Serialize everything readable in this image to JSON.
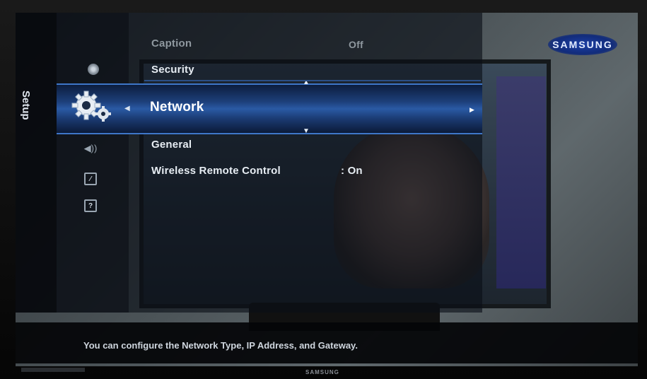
{
  "osd": {
    "category_label": "Setup",
    "menu_items": [
      {
        "label": "Caption",
        "value": "Off"
      },
      {
        "label": "Security"
      },
      {
        "label": "Network"
      },
      {
        "label": "General"
      },
      {
        "label": "Wireless Remote Control",
        "value": ": On"
      }
    ],
    "selected_index": 2,
    "help_text": "You can configure the Network Type, IP Address, and Gateway."
  },
  "icons": {
    "disc": "disc-icon",
    "setup": "gear-icon",
    "input": "speaker-icon",
    "support": "picture-icon",
    "help": "question-icon"
  },
  "branding": {
    "corner_badge": "SAMSUNG",
    "bezel_logo": "SAMSUNG"
  },
  "colors": {
    "highlight": "#2a5aa4",
    "osd_text": "#e7edf3"
  }
}
